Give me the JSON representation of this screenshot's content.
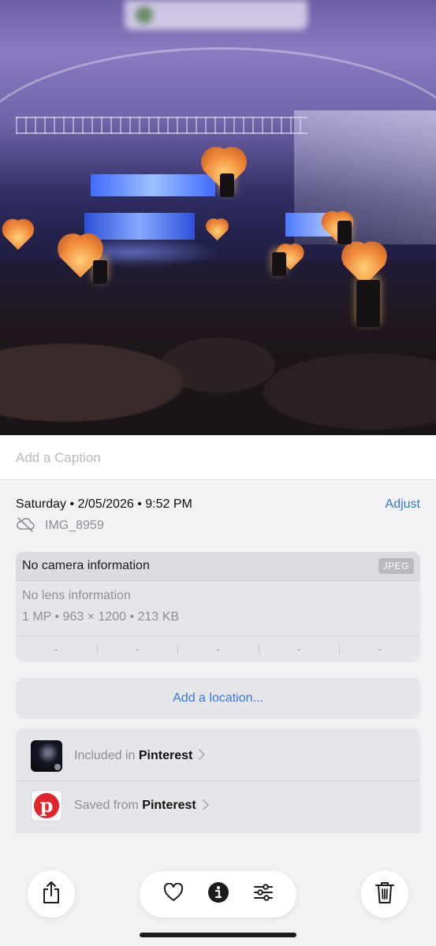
{
  "caption": {
    "placeholder": "Add a Caption"
  },
  "meta": {
    "day": "Saturday",
    "date": "2/05/2026",
    "time": "9:52 PM",
    "separator": "•",
    "adjust_label": "Adjust",
    "filename": "IMG_8959",
    "cloud_icon": "cloud-slash-icon"
  },
  "camera": {
    "title": "No camera information",
    "format_badge": "JPEG",
    "lens": "No lens information",
    "specs": "1 MP • 963 × 1200 • 213 KB",
    "cells": [
      "-",
      "-",
      "-",
      "-",
      "-"
    ]
  },
  "location": {
    "label": "Add a location..."
  },
  "included": {
    "prefix": "Included in",
    "name": "Pinterest"
  },
  "saved": {
    "prefix": "Saved from",
    "name": "Pinterest",
    "logo_letter": "p"
  },
  "toolbar": {
    "share_icon": "share-icon",
    "favorite_icon": "heart-icon",
    "info_icon": "info-icon",
    "edit_icon": "sliders-icon",
    "delete_icon": "trash-icon"
  },
  "colors": {
    "accent": "#3478d4",
    "background": "#f2f2f4",
    "card": "#e6e6ea",
    "pinterest": "#e0242b"
  }
}
